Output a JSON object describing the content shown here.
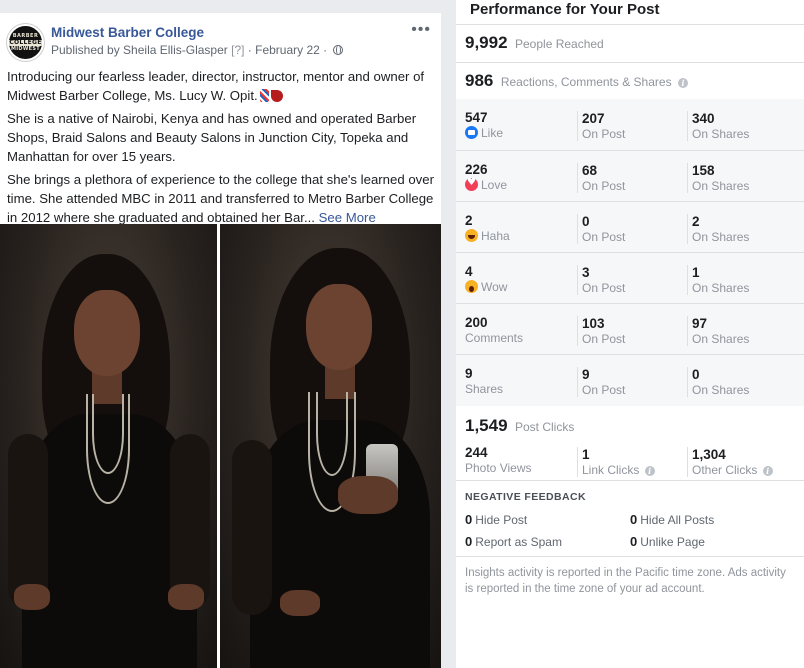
{
  "post": {
    "page_name": "Midwest Barber College",
    "published_by": "Published by Sheila Ellis-Glasper",
    "question_mark": "[?]",
    "date": "· February 22 ·",
    "more": "•••",
    "avatar_text": [
      "BARBER",
      "COLLEGE",
      "MIDWEST"
    ],
    "paragraphs": [
      "Introducing our fearless leader, director, instructor, mentor and owner of Midwest Barber College, Ms. Lucy W. Opit.",
      "She is a native of Nairobi, Kenya and has owned and operated Barber Shops, Braid Salons and Beauty Salons in Junction City, Topeka and Manhattan for over 15 years.",
      "She brings a plethora of experience to the college that she's learned over time. She attended MBC in 2011 and transferred to Metro Barber College in 2012 where she graduated and obtained her Bar..."
    ],
    "see_more": "See More"
  },
  "insights": {
    "title": "Performance for Your Post",
    "people_reached": {
      "value": "9,992",
      "label": "People Reached"
    },
    "engagement": {
      "value": "986",
      "label": "Reactions, Comments & Shares"
    },
    "reactions": [
      {
        "icon": "like-icon",
        "value": "547",
        "label": "Like",
        "on_post": "207",
        "on_shares": "340"
      },
      {
        "icon": "love-icon",
        "value": "226",
        "label": "Love",
        "on_post": "68",
        "on_shares": "158"
      },
      {
        "icon": "haha-icon",
        "value": "2",
        "label": "Haha",
        "on_post": "0",
        "on_shares": "2"
      },
      {
        "icon": "wow-icon",
        "value": "4",
        "label": "Wow",
        "on_post": "3",
        "on_shares": "1"
      },
      {
        "icon": "",
        "value": "200",
        "label": "Comments",
        "on_post": "103",
        "on_shares": "97"
      },
      {
        "icon": "",
        "value": "9",
        "label": "Shares",
        "on_post": "9",
        "on_shares": "0"
      }
    ],
    "on_post_label": "On Post",
    "on_shares_label": "On Shares",
    "post_clicks": {
      "value": "1,549",
      "label": "Post Clicks"
    },
    "clicks": [
      {
        "value": "244",
        "label": "Photo Views"
      },
      {
        "value": "1",
        "label": "Link Clicks"
      },
      {
        "value": "1,304",
        "label": "Other Clicks"
      }
    ],
    "negative_feedback": {
      "title": "NEGATIVE FEEDBACK",
      "items": [
        {
          "value": "0",
          "label": "Hide Post"
        },
        {
          "value": "0",
          "label": "Hide All Posts"
        },
        {
          "value": "0",
          "label": "Report as Spam"
        },
        {
          "value": "0",
          "label": "Unlike Page"
        }
      ]
    },
    "note": "Insights activity is reported in the Pacific time zone. Ads activity is reported in the time zone of your ad account.",
    "info_glyph": "i"
  },
  "colors": {
    "link_blue": "#385898",
    "like_blue": "#1877f2",
    "love_red": "#f33e58",
    "reaction_yellow": "#f7b125"
  }
}
